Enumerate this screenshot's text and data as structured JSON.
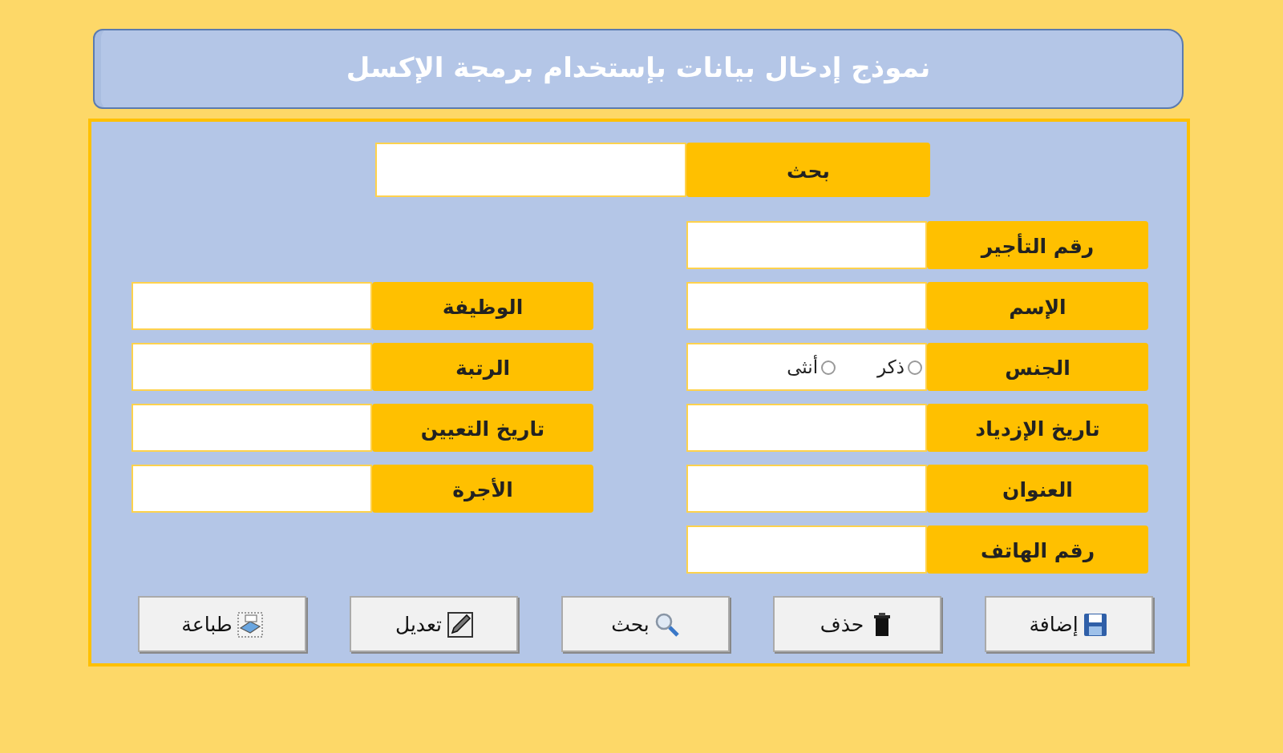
{
  "title": "نموذج إدخال بيانات بإستخدام برمجة الإكسل",
  "search": {
    "label": "بحث"
  },
  "right_fields": [
    {
      "kind": "text",
      "label": "رقم التأجير"
    },
    {
      "kind": "text",
      "label": "الإسم"
    },
    {
      "kind": "radio",
      "label": "الجنس",
      "options": [
        {
          "label": "ذكر",
          "selected": false
        },
        {
          "label": "أنثى",
          "selected": false
        }
      ]
    },
    {
      "kind": "text",
      "label": "تاريخ الإزدياد"
    },
    {
      "kind": "text",
      "label": "العنوان"
    },
    {
      "kind": "text",
      "label": "رقم الهاتف"
    }
  ],
  "left_fields": [
    {
      "kind": "text",
      "label": "الوظيفة"
    },
    {
      "kind": "text",
      "label": "الرتبة"
    },
    {
      "kind": "text",
      "label": "تاريخ التعيين"
    },
    {
      "kind": "text",
      "label": "الأجرة"
    }
  ],
  "buttons": [
    {
      "kind": "save",
      "label": "إضافة"
    },
    {
      "kind": "delete",
      "label": "حذف"
    },
    {
      "kind": "search",
      "label": "بحث"
    },
    {
      "kind": "edit",
      "label": "تعديل"
    },
    {
      "kind": "print",
      "label": "طباعة"
    }
  ]
}
